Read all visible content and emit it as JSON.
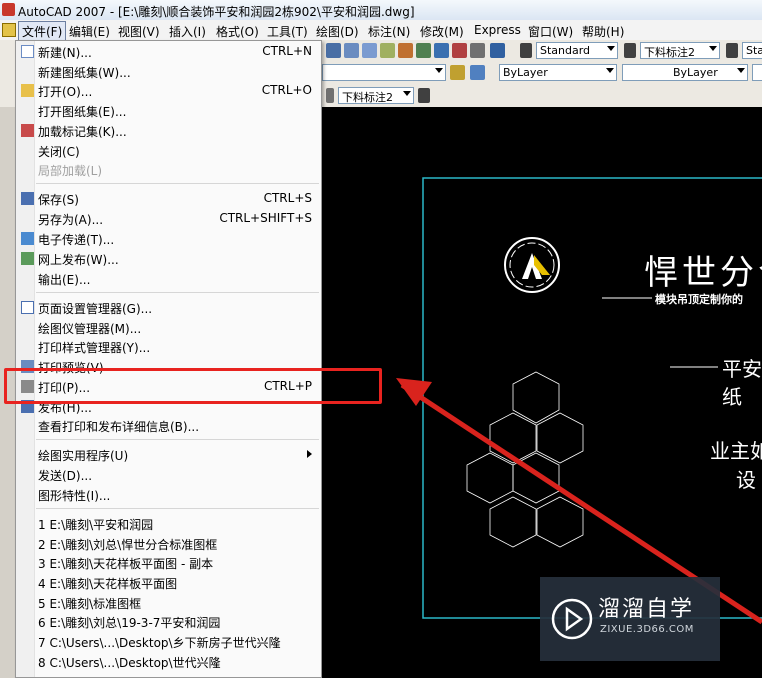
{
  "window": {
    "title": "AutoCAD 2007 - [E:\\雕刻\\顺合装饰平安和润园2栋902\\平安和润园.dwg]"
  },
  "menubar": {
    "items": [
      "文件(F)",
      "编辑(E)",
      "视图(V)",
      "插入(I)",
      "格式(O)",
      "工具(T)",
      "绘图(D)",
      "标注(N)",
      "修改(M)",
      "Express",
      "窗口(W)",
      "帮助(H)"
    ]
  },
  "toolbar": {
    "text_style": "Standard",
    "dim_style": "下料标注2",
    "table_style_partial": "Sta",
    "color": "ByLayer",
    "linetype": "ByLayer",
    "dim_style_2": "下料标注2"
  },
  "file_menu": {
    "items": [
      {
        "label": "新建(N)...",
        "shortcut": "CTRL+N",
        "icon": "new-file-icon"
      },
      {
        "label": "新建图纸集(W)...",
        "shortcut": ""
      },
      {
        "label": "打开(O)...",
        "shortcut": "CTRL+O",
        "icon": "open-folder-icon"
      },
      {
        "label": "打开图纸集(E)...",
        "shortcut": ""
      },
      {
        "label": "加载标记集(K)...",
        "shortcut": "",
        "icon": "markup-set-icon"
      },
      {
        "label": "关闭(C)",
        "shortcut": ""
      },
      {
        "label": "局部加载(L)",
        "shortcut": "",
        "disabled": true
      },
      {
        "label": "保存(S)",
        "shortcut": "CTRL+S",
        "icon": "save-icon"
      },
      {
        "label": "另存为(A)...",
        "shortcut": "CTRL+SHIFT+S"
      },
      {
        "label": "电子传递(T)...",
        "shortcut": "",
        "icon": "etransmit-icon"
      },
      {
        "label": "网上发布(W)...",
        "shortcut": "",
        "icon": "publish-web-icon"
      },
      {
        "label": "输出(E)...",
        "shortcut": ""
      },
      {
        "label": "页面设置管理器(G)...",
        "shortcut": "",
        "icon": "page-setup-icon"
      },
      {
        "label": "绘图仪管理器(M)...",
        "shortcut": ""
      },
      {
        "label": "打印样式管理器(Y)...",
        "shortcut": ""
      },
      {
        "label": "打印预览(V)",
        "shortcut": "",
        "icon": "print-preview-icon"
      },
      {
        "label": "打印(P)...",
        "shortcut": "CTRL+P",
        "icon": "print-icon"
      },
      {
        "label": "发布(H)...",
        "shortcut": "",
        "icon": "publish-icon"
      },
      {
        "label": "查看打印和发布详细信息(B)...",
        "shortcut": ""
      },
      {
        "label": "绘图实用程序(U)",
        "shortcut": "",
        "submenu": true
      },
      {
        "label": "发送(D)...",
        "shortcut": ""
      },
      {
        "label": "图形特性(I)...",
        "shortcut": ""
      },
      {
        "label": "1 E:\\雕刻\\平安和润园",
        "shortcut": ""
      },
      {
        "label": "2 E:\\雕刻\\刘总\\悍世分合标准图框",
        "shortcut": ""
      },
      {
        "label": "3 E:\\雕刻\\天花样板平面图 - 副本",
        "shortcut": ""
      },
      {
        "label": "4 E:\\雕刻\\天花样板平面图",
        "shortcut": ""
      },
      {
        "label": "5 E:\\雕刻\\标准图框",
        "shortcut": ""
      },
      {
        "label": "6 E:\\雕刻\\刘总\\19-3-7平安和润园",
        "shortcut": ""
      },
      {
        "label": "7 C:\\Users\\...\\Desktop\\乡下新房子世代兴隆",
        "shortcut": ""
      },
      {
        "label": "8 C:\\Users\\...\\Desktop\\世代兴隆",
        "shortcut": ""
      }
    ]
  },
  "drawing": {
    "title_line": "悍世分合",
    "subtitle_line": "模块吊顶定制你的",
    "project_line_1": "平安",
    "project_line_2": "纸",
    "owner_line_1": "业主如",
    "owner_line_2": "设"
  },
  "watermark": {
    "title": "溜溜自学",
    "url": "ZIXUE.3D66.COM"
  },
  "colors": {
    "highlight": "#e8231f",
    "frame": "#2ab8c8",
    "accent": "#ffffff"
  }
}
